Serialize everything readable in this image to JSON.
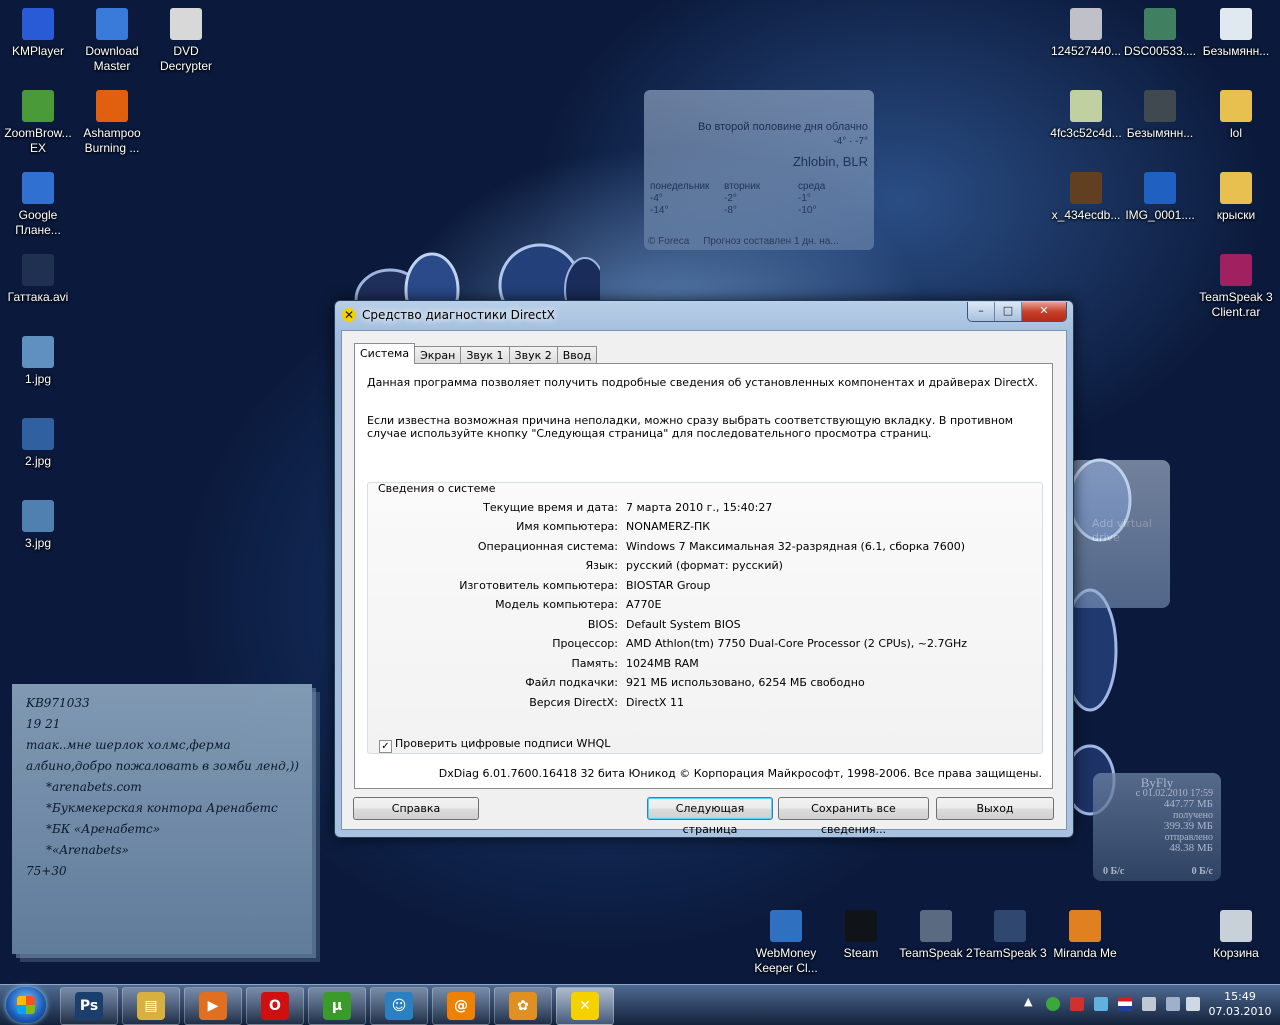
{
  "desktop": {
    "left_icons": [
      {
        "label": "KMPlayer",
        "icon": "kmplayer-icon",
        "color": "#2a5bd7"
      },
      {
        "label": "Download Master",
        "icon": "download-master-icon",
        "color": "#3a7ad8"
      },
      {
        "label": "DVD Decrypter",
        "icon": "dvd-icon",
        "color": "#d8d8d8"
      },
      {
        "label": "ZoomBrow... EX",
        "icon": "zoombrowser-icon",
        "color": "#4a9a3a"
      },
      {
        "label": "Ashampoo Burning ...",
        "icon": "ashampoo-icon",
        "color": "#e06010"
      },
      {
        "label": "Google Плане...",
        "icon": "google-earth-icon",
        "color": "#3070d0"
      },
      {
        "label": "Гаттака.avi",
        "icon": "video-file-icon",
        "color": "#203050"
      },
      {
        "label": "1.jpg",
        "icon": "image-file-icon",
        "color": "#6090c0"
      },
      {
        "label": "2.jpg",
        "icon": "image-file-icon",
        "color": "#3060a0"
      },
      {
        "label": "3.jpg",
        "icon": "image-file-icon",
        "color": "#5080b0"
      }
    ],
    "right_icons": [
      {
        "label": "124527440...",
        "icon": "image-file-icon",
        "color": "#c0c0c8"
      },
      {
        "label": "DSC00533....",
        "icon": "image-file-icon",
        "color": "#408060"
      },
      {
        "label": "Безымянн...",
        "icon": "image-file-icon",
        "color": "#e0e8f0"
      },
      {
        "label": "4fc3c52c4d...",
        "icon": "image-file-icon",
        "color": "#c0d0a0"
      },
      {
        "label": "Безымянн...",
        "icon": "image-file-icon",
        "color": "#404850"
      },
      {
        "label": "lol",
        "icon": "folder-icon",
        "color": "#e8c050"
      },
      {
        "label": "x_434ecdb...",
        "icon": "image-file-icon",
        "color": "#604020"
      },
      {
        "label": "IMG_0001....",
        "icon": "image-file-icon",
        "color": "#2060c0"
      },
      {
        "label": "крыски",
        "icon": "folder-icon",
        "color": "#e8c050"
      },
      {
        "label": "TeamSpeak 3 Client.rar",
        "icon": "winrar-icon",
        "color": "#a02060"
      }
    ],
    "bottom_icons": [
      {
        "label": "WebMoney Keeper Cl...",
        "icon": "webmoney-icon",
        "color": "#3070c0"
      },
      {
        "label": "Steam",
        "icon": "steam-icon",
        "color": "#101418"
      },
      {
        "label": "TeamSpeak 2",
        "icon": "teamspeak2-icon",
        "color": "#5a6a80"
      },
      {
        "label": "TeamSpeak 3",
        "icon": "teamspeak3-icon",
        "color": "#304870"
      },
      {
        "label": "Miranda Me",
        "icon": "miranda-icon",
        "color": "#e08020"
      },
      {
        "label": "Корзина",
        "icon": "recycle-bin-icon",
        "color": "#c8d0d8"
      }
    ]
  },
  "weather": {
    "condition": "Во второй половине дня облачно",
    "temps": "-4° · -7°",
    "city": "Zhlobin, BLR",
    "days": [
      {
        "name": "понедельник",
        "hi": "-4°",
        "lo": "-14°"
      },
      {
        "name": "вторник",
        "hi": "-2°",
        "lo": "-8°"
      },
      {
        "name": "среда",
        "hi": "-1°",
        "lo": "-10°"
      }
    ],
    "source": "© Foreca",
    "forecast": "Прогноз составлен 1 дн. на..."
  },
  "daemon": {
    "text": "Add virtual drive"
  },
  "byfly": {
    "title": "ByFly",
    "since": "с 01.02.2010 17:59",
    "total": "447.77 МБ",
    "recv_label": "получено",
    "recv": "399.39 МБ",
    "sent_label": "отправлено",
    "sent": "48.38 МБ",
    "speed_in": "0 Б/с",
    "speed_out": "0 Б/с"
  },
  "note": {
    "lines": [
      "KB971033",
      "19 21",
      "таак..мне шерлок холмс,ферма",
      "албино,добро пожаловать в зомби ленд,))",
      "*arenabets.com",
      "*Букмекерская контора Аренабетс",
      "*БК «Аренабетс»",
      "*«Arenabets»",
      "75+30"
    ]
  },
  "dialog": {
    "title": "Средство диагностики DirectX",
    "controls": {
      "minimize": "–",
      "maximize": "□",
      "close": "✕"
    },
    "tabs": [
      "Система",
      "Экран",
      "Звук 1",
      "Звук 2",
      "Ввод"
    ],
    "intro1": "Данная программа позволяет получить подробные сведения об установленных компонентах и драйверах DirectX.",
    "intro2": "Если известна возможная причина неполадки, можно сразу выбрать соответствующую вкладку. В противном случае используйте кнопку \"Следующая страница\" для последовательного просмотра страниц.",
    "group_title": "Сведения о системе",
    "info": [
      {
        "label": "Текущие время и дата:",
        "value": "7 марта 2010 г., 15:40:27"
      },
      {
        "label": "Имя компьютера:",
        "value": "NONAMERZ-ПК"
      },
      {
        "label": "Операционная система:",
        "value": "Windows 7 Максимальная 32-разрядная (6.1, сборка 7600)"
      },
      {
        "label": "Язык:",
        "value": "русский (формат: русский)"
      },
      {
        "label": "Изготовитель компьютера:",
        "value": "BIOSTAR Group"
      },
      {
        "label": "Модель компьютера:",
        "value": "A770E"
      },
      {
        "label": "BIOS:",
        "value": "Default System BIOS"
      },
      {
        "label": "Процессор:",
        "value": "AMD Athlon(tm) 7750 Dual-Core Processor (2 CPUs), ~2.7GHz"
      },
      {
        "label": "Память:",
        "value": "1024MB RAM"
      },
      {
        "label": "Файл подкачки:",
        "value": "921 МБ использовано, 6254 МБ свободно"
      },
      {
        "label": "Версия DirectX:",
        "value": "DirectX 11"
      }
    ],
    "whql_label": "Проверить цифровые подписи WHQL",
    "whql_checked": true,
    "footer": "DxDiag 6.01.7600.16418 32 бита Юникод  © Корпорация Майкрософт, 1998-2006.  Все права защищены.",
    "buttons": {
      "help": "Справка",
      "next": "Следующая страница",
      "save": "Сохранить все сведения...",
      "exit": "Выход"
    }
  },
  "taskbar": {
    "apps": [
      {
        "name": "Photoshop",
        "icon": "photoshop-icon",
        "glyph": "Ps",
        "color": "#1a3e6e"
      },
      {
        "name": "Explorer",
        "icon": "folder-icon",
        "glyph": "▤",
        "color": "#d8b040"
      },
      {
        "name": "Media Player",
        "icon": "media-player-icon",
        "glyph": "▶",
        "color": "#e07020"
      },
      {
        "name": "Opera",
        "icon": "opera-icon",
        "glyph": "O",
        "color": "#d01010"
      },
      {
        "name": "uTorrent",
        "icon": "utorrent-icon",
        "glyph": "µ",
        "color": "#3a9a2a"
      },
      {
        "name": "QIP",
        "icon": "messenger-icon",
        "glyph": "☺",
        "color": "#2a80c0"
      },
      {
        "name": "Mail Agent",
        "icon": "mail-agent-icon",
        "glyph": "@",
        "color": "#f08000"
      },
      {
        "name": "Miranda",
        "icon": "miranda-icon",
        "glyph": "✿",
        "color": "#e09020"
      },
      {
        "name": "DirectX Diagnostic",
        "icon": "directx-icon",
        "glyph": "✕",
        "color": "#f5d100"
      }
    ],
    "clock_time": "15:49",
    "clock_date": "07.03.2010"
  }
}
